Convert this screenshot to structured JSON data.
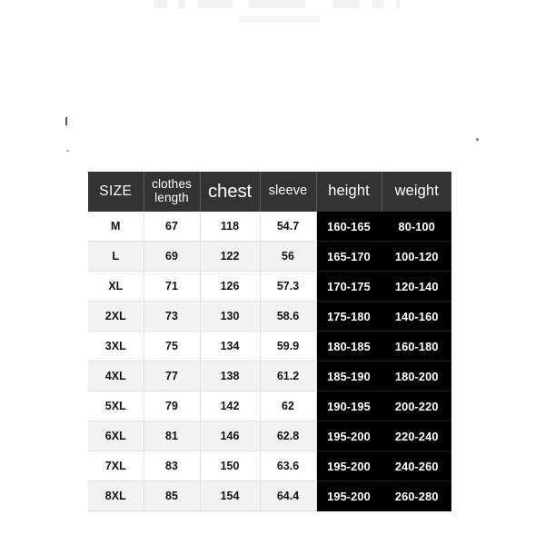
{
  "page": {
    "background_color": "#ffffff",
    "header_bg_color": "#333333",
    "dark_cell_bg_color": "#000000",
    "alt_row_bg_color": "#f2f2f2"
  },
  "table": {
    "headers": [
      {
        "key": "size",
        "label": "SIZE",
        "lines": [
          "SIZE"
        ]
      },
      {
        "key": "length",
        "label": "clothes length",
        "lines": [
          "clothes",
          "length"
        ]
      },
      {
        "key": "chest",
        "label": "chest",
        "lines": [
          "chest"
        ]
      },
      {
        "key": "sleeve",
        "label": "sleeve",
        "lines": [
          "sleeve"
        ]
      },
      {
        "key": "height",
        "label": "height",
        "lines": [
          "height"
        ]
      },
      {
        "key": "weight",
        "label": "weight",
        "lines": [
          "weight"
        ]
      }
    ],
    "rows": [
      {
        "size": "M",
        "length": "67",
        "chest": "118",
        "sleeve": "54.7",
        "height": "160-165",
        "weight": "80-100"
      },
      {
        "size": "L",
        "length": "69",
        "chest": "122",
        "sleeve": "56",
        "height": "165-170",
        "weight": "100-120"
      },
      {
        "size": "XL",
        "length": "71",
        "chest": "126",
        "sleeve": "57.3",
        "height": "170-175",
        "weight": "120-140"
      },
      {
        "size": "2XL",
        "length": "73",
        "chest": "130",
        "sleeve": "58.6",
        "height": "175-180",
        "weight": "140-160"
      },
      {
        "size": "3XL",
        "length": "75",
        "chest": "134",
        "sleeve": "59.9",
        "height": "180-185",
        "weight": "160-180"
      },
      {
        "size": "4XL",
        "length": "77",
        "chest": "138",
        "sleeve": "61.2",
        "height": "185-190",
        "weight": "180-200"
      },
      {
        "size": "5XL",
        "length": "79",
        "chest": "142",
        "sleeve": "62",
        "height": "190-195",
        "weight": "200-220"
      },
      {
        "size": "6XL",
        "length": "81",
        "chest": "146",
        "sleeve": "62.8",
        "height": "195-200",
        "weight": "220-240"
      },
      {
        "size": "7XL",
        "length": "83",
        "chest": "150",
        "sleeve": "63.6",
        "height": "195-200",
        "weight": "240-260"
      },
      {
        "size": "8XL",
        "length": "85",
        "chest": "154",
        "sleeve": "64.4",
        "height": "195-200",
        "weight": "260-280"
      }
    ]
  }
}
